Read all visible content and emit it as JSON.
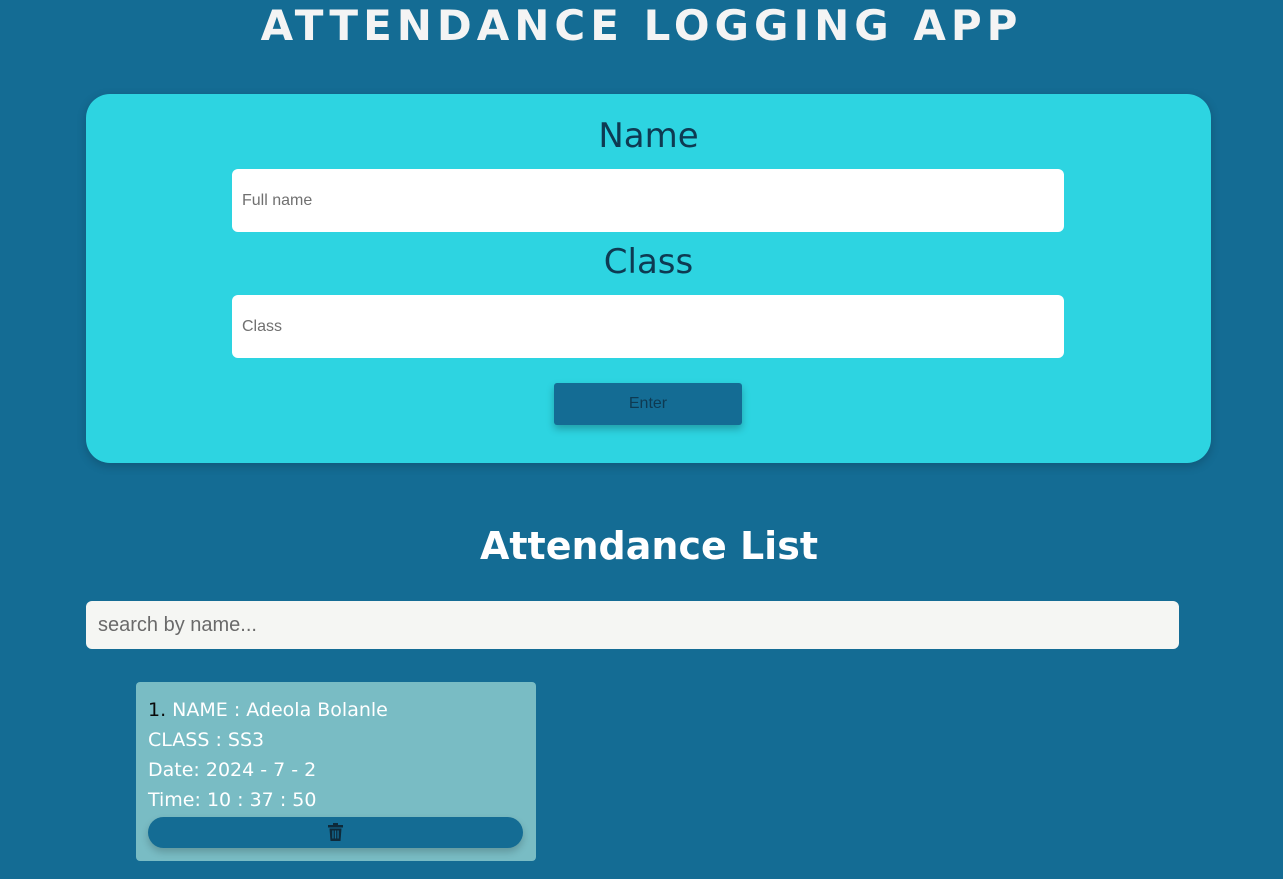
{
  "header": {
    "title": "ATTENDANCE LOGGING APP"
  },
  "form": {
    "name_label": "Name",
    "name_placeholder": "Full name",
    "name_value": "",
    "class_label": "Class",
    "class_placeholder": "Class",
    "class_value": "",
    "enter_label": "Enter"
  },
  "list": {
    "title": "Attendance List",
    "search_placeholder": "search by name...",
    "entries": [
      {
        "number": "1.",
        "name_line": " NAME : Adeola Bolanle",
        "class_line": "CLASS : SS3",
        "date_line": "Date: 2024 - 7 - 2",
        "time_line": "Time: 10 : 37 : 50",
        "delete_icon": "trash-icon"
      }
    ]
  },
  "colors": {
    "background": "#146c94",
    "form_card": "#2dd4e1",
    "entry_card": "#79bcc4",
    "button": "#146c94",
    "label_text": "#0e3a52"
  }
}
